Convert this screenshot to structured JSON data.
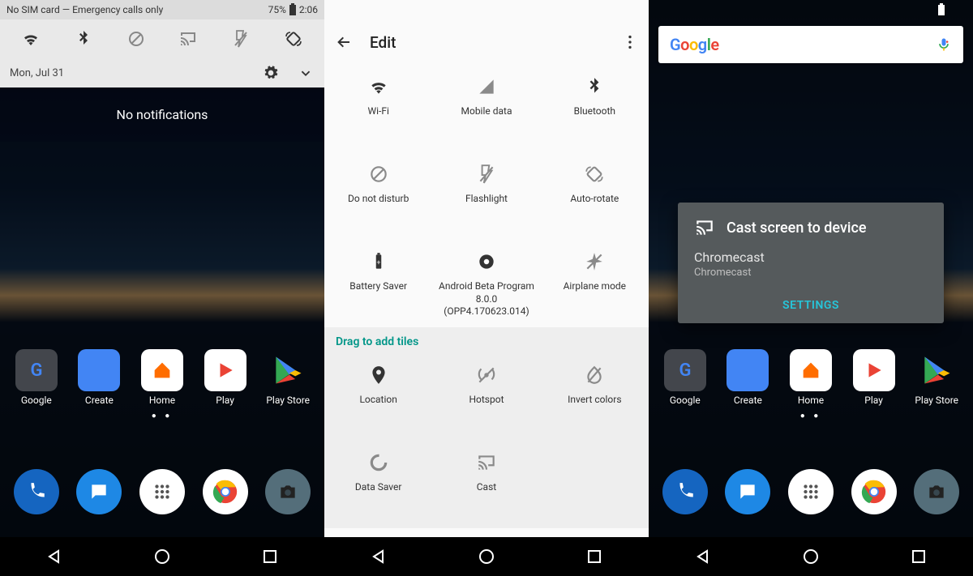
{
  "shared": {
    "time": "2:06"
  },
  "phone1": {
    "status_left": "No SIM card — Emergency calls only",
    "battery": "75%",
    "qs": [
      "wifi",
      "bluetooth",
      "dnd",
      "cast",
      "flashlight",
      "rotate"
    ],
    "date": "Mon, Jul 31",
    "no_notifications": "No notifications",
    "apps_row": [
      {
        "label": "Google",
        "icon": "google"
      },
      {
        "label": "Create",
        "icon": "docs"
      },
      {
        "label": "Home",
        "icon": "home"
      },
      {
        "label": "Play",
        "icon": "play-movies"
      },
      {
        "label": "Play Store",
        "icon": "play-store"
      }
    ],
    "dock": [
      "phone",
      "messages",
      "apps",
      "chrome",
      "camera"
    ]
  },
  "phone2": {
    "title": "Edit",
    "tiles_top": [
      {
        "label": "Wi-Fi",
        "icon": "wifi"
      },
      {
        "label": "Mobile data",
        "icon": "signal"
      },
      {
        "label": "Bluetooth",
        "icon": "bluetooth"
      },
      {
        "label": "Do not disturb",
        "icon": "dnd"
      },
      {
        "label": "Flashlight",
        "icon": "flashlight"
      },
      {
        "label": "Auto-rotate",
        "icon": "rotate"
      },
      {
        "label": "Battery Saver",
        "icon": "battery"
      },
      {
        "label": "Android Beta Program 8.0.0 (OPP4.170623.014)",
        "icon": "dot"
      },
      {
        "label": "Airplane mode",
        "icon": "airplane"
      }
    ],
    "drag_header": "Drag to add tiles",
    "tiles_bottom": [
      {
        "label": "Location",
        "icon": "location"
      },
      {
        "label": "Hotspot",
        "icon": "hotspot"
      },
      {
        "label": "Invert colors",
        "icon": "invert"
      },
      {
        "label": "Data Saver",
        "icon": "datasaver"
      },
      {
        "label": "Cast",
        "icon": "cast"
      }
    ]
  },
  "phone3": {
    "search_hint": "Google",
    "cast_title": "Cast screen to device",
    "device_name": "Chromecast",
    "device_sub": "Chromecast",
    "settings": "SETTINGS",
    "apps_row": [
      {
        "label": "Google",
        "icon": "google"
      },
      {
        "label": "Create",
        "icon": "docs"
      },
      {
        "label": "Home",
        "icon": "home"
      },
      {
        "label": "Play",
        "icon": "play-movies"
      },
      {
        "label": "Play Store",
        "icon": "play-store"
      }
    ],
    "dock": [
      "phone",
      "messages",
      "apps",
      "chrome",
      "camera"
    ]
  }
}
